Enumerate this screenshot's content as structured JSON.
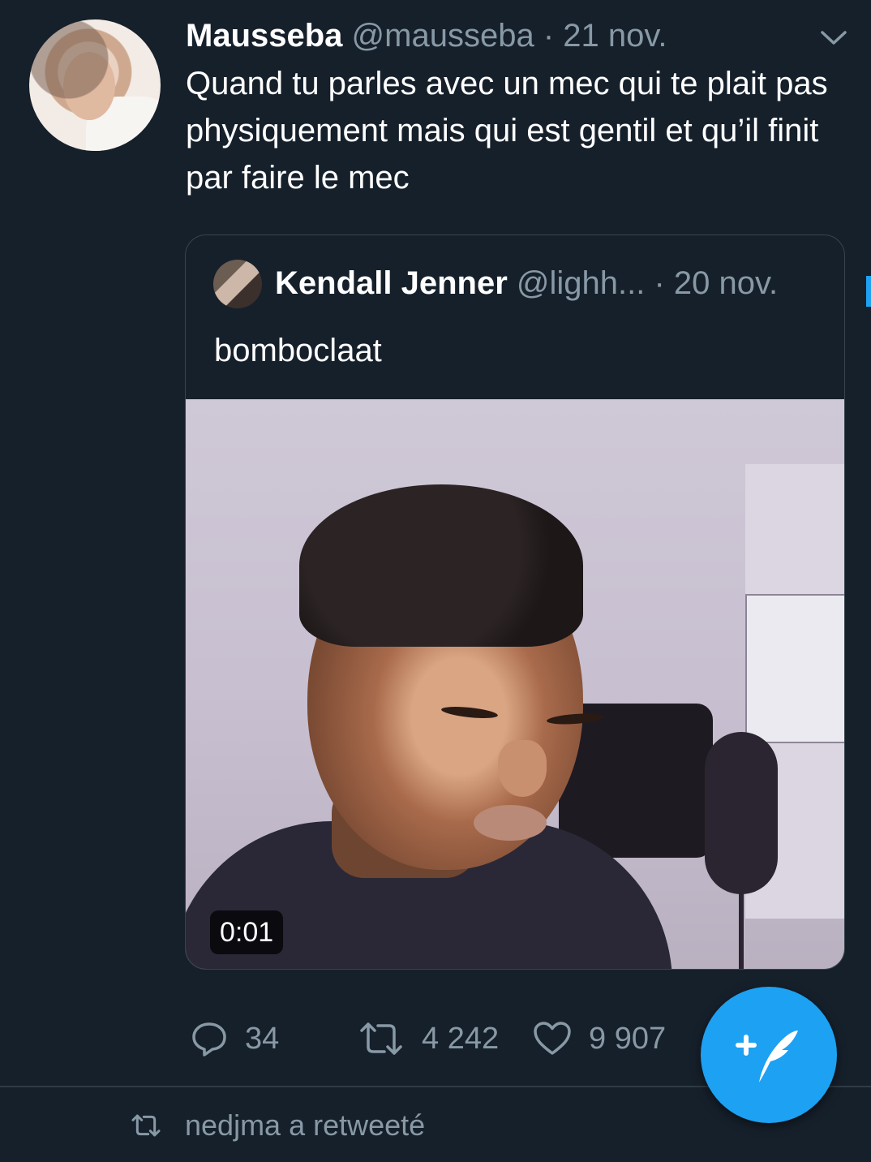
{
  "tweet": {
    "author_name": "Mausseba",
    "author_handle": "@mausseba",
    "separator": "·",
    "date": "21 nov.",
    "text": "Quand tu parles avec un mec qui te plait pas physiquement mais qui est gentil et qu’il finit par faire le mec"
  },
  "quoted": {
    "author_name": "Kendall Jenner",
    "author_handle": "@lighh...",
    "date": "· 20 nov.",
    "text": "bomboclaat",
    "video_duration": "0:01"
  },
  "actions": {
    "replies": "34",
    "retweets": "4 242",
    "likes": "9 907"
  },
  "retweet_notice": "nedjma a retweeté",
  "colors": {
    "background": "#16202b",
    "secondary_text": "#8899a6",
    "accent": "#1da1f2",
    "border": "#38444d"
  },
  "icons": [
    "chevron-down-icon",
    "reply-icon",
    "retweet-icon",
    "like-icon",
    "compose-tweet-icon"
  ]
}
